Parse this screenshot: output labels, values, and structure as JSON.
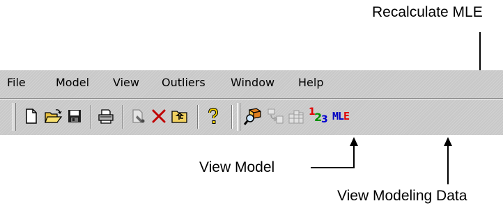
{
  "annotations": {
    "recalculate_mle": "Recalculate MLE",
    "view_model": "View Model",
    "view_modeling_data": "View Modeling Data"
  },
  "menu": [
    "File",
    "Model",
    "View",
    "Outliers",
    "Window",
    "Help"
  ],
  "toolbar": {
    "icons": [
      "new-file-icon",
      "open-folder-icon",
      "save-disk-icon",
      "print-icon",
      "page-properties-icon",
      "delete-x-icon",
      "up-folder-icon",
      "help-question-icon",
      "view-model-icon",
      "transform-icon",
      "grid-icon",
      "view-modeling-data-icon",
      "recalculate-mle-icon"
    ],
    "modeling_data_digits": {
      "d1": "1",
      "d2": "2",
      "d3": "3"
    },
    "mle_letters": {
      "m": "M",
      "l": "L",
      "e": "E"
    }
  },
  "colors": {
    "toolbar_bg": "#c8c8c8",
    "digit_1": "#e00000",
    "digit_2": "#009000",
    "digit_3": "#0000d0",
    "mle_m": "#0000c0",
    "mle_l": "#0000c0",
    "mle_e": "#e00000"
  }
}
